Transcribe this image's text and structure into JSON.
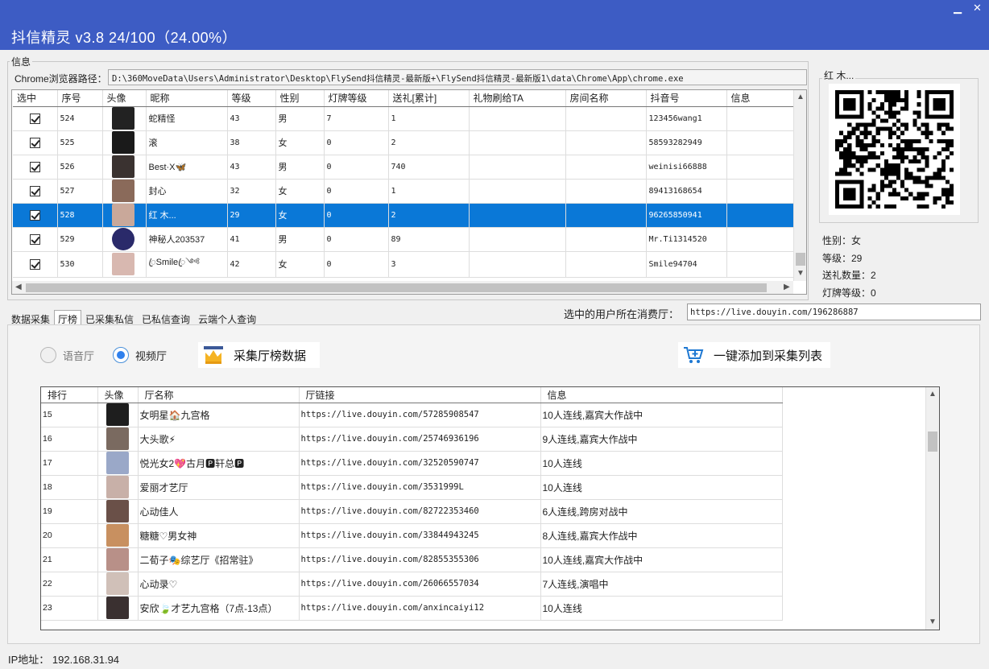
{
  "window": {
    "title": "抖信精灵 v3.8  24/100（24.00%）",
    "minimize": "▁",
    "close": "✕"
  },
  "info_group": {
    "label": "信息",
    "path_label": "Chrome浏览器路径：",
    "path_value": "D:\\360MoveData\\Users\\Administrator\\Desktop\\FlySend抖信精灵-最新版+\\FlySend抖信精灵-最新版1\\data\\Chrome\\App\\chrome.exe"
  },
  "user_table": {
    "columns": [
      "选中",
      "序号",
      "头像",
      "昵称",
      "等级",
      "性别",
      "灯牌等级",
      "送礼[累计]",
      "礼物刷给TA",
      "房间名称",
      "抖音号",
      "信息"
    ],
    "rows": [
      {
        "seq": "524",
        "nick": "蛇精怪",
        "level": "43",
        "gender": "男",
        "badge": "7",
        "gift": "1",
        "gift_to": "",
        "room": "",
        "douyin": "123456wang1",
        "info": "",
        "avatar_color": "#222222"
      },
      {
        "seq": "525",
        "nick": "滚",
        "level": "38",
        "gender": "女",
        "badge": "0",
        "gift": "2",
        "gift_to": "",
        "room": "",
        "douyin": "58593282949",
        "info": "",
        "avatar_color": "#1a1a1a"
      },
      {
        "seq": "526",
        "nick": "Best·X🦋",
        "level": "43",
        "gender": "男",
        "badge": "0",
        "gift": "740",
        "gift_to": "",
        "room": "",
        "douyin": "weinisi66888",
        "info": "",
        "avatar_color": "#3a3230"
      },
      {
        "seq": "527",
        "nick": "封心",
        "level": "32",
        "gender": "女",
        "badge": "0",
        "gift": "1",
        "gift_to": "",
        "room": "",
        "douyin": "89413168654",
        "info": "",
        "avatar_color": "#8a6a5a"
      },
      {
        "seq": "528",
        "nick": "红 木...",
        "level": "29",
        "gender": "女",
        "badge": "0",
        "gift": "2",
        "gift_to": "",
        "room": "",
        "douyin": "96265850941",
        "info": "",
        "avatar_color": "#c9a89a"
      },
      {
        "seq": "529",
        "nick": "神秘人203537",
        "level": "41",
        "gender": "男",
        "badge": "0",
        "gift": "89",
        "gift_to": "",
        "room": "",
        "douyin": "Mr.Ti1314520",
        "info": "",
        "avatar_color": "#2a2a6a"
      },
      {
        "seq": "530",
        "nick": "ꦿSmileꦿ༺",
        "level": "42",
        "gender": "女",
        "badge": "0",
        "gift": "3",
        "gift_to": "",
        "room": "",
        "douyin": "Smile94704",
        "info": "",
        "avatar_color": "#d8b8b0"
      }
    ],
    "selected_index": 4,
    "selected_color": "#0a78d7"
  },
  "profile": {
    "name": "红 木...",
    "gender": "性别：女",
    "level": "等级：29",
    "gift_count": "送礼数量：2",
    "badge_level": "灯牌等级：0"
  },
  "tabs": [
    {
      "label": "数据采集",
      "active": false
    },
    {
      "label": "厅榜",
      "active": true
    },
    {
      "label": "已采集私信",
      "active": false
    },
    {
      "label": "已私信查询",
      "active": false
    },
    {
      "label": "云端个人查询",
      "active": false
    }
  ],
  "hall_field": {
    "label": "选中的用户所在消费厅：",
    "value": "https://live.douyin.com/196286887"
  },
  "hall_panel": {
    "radio_voice": "语音厅",
    "radio_video": "视频厅",
    "collect_button": "采集厅榜数据",
    "add_button": "一键添加到采集列表",
    "columns": [
      "排行",
      "头像",
      "厅名称",
      "厅链接",
      "信息"
    ],
    "rows": [
      {
        "rank": "15",
        "name": "女明星🏠九宫格",
        "link": "https://live.douyin.com/57285908547",
        "info": "10人连线,嘉宾大作战中",
        "avatar_color": "#1e1e1e"
      },
      {
        "rank": "16",
        "name": "大头歌⚡",
        "link": "https://live.douyin.com/25746936196",
        "info": "9人连线,嘉宾大作战中",
        "avatar_color": "#7a6a60"
      },
      {
        "rank": "17",
        "name": "悦光女2💖古月🅿轩总🅿",
        "link": "https://live.douyin.com/32520590747",
        "info": "10人连线",
        "avatar_color": "#9aa8c8"
      },
      {
        "rank": "18",
        "name": "爱丽才艺厅",
        "link": "https://live.douyin.com/3531999L",
        "info": "10人连线",
        "avatar_color": "#c8b0a8"
      },
      {
        "rank": "19",
        "name": "心动佳人",
        "link": "https://live.douyin.com/82722353460",
        "info": "6人连线,跨房对战中",
        "avatar_color": "#6a5048"
      },
      {
        "rank": "20",
        "name": "糖糖♡男女神",
        "link": "https://live.douyin.com/33844943245",
        "info": "8人连线,嘉宾大作战中",
        "avatar_color": "#c89060"
      },
      {
        "rank": "21",
        "name": "二荀子🎭综艺厅《招常驻》",
        "link": "https://live.douyin.com/82855355306",
        "info": "10人连线,嘉宾大作战中",
        "avatar_color": "#b89088"
      },
      {
        "rank": "22",
        "name": "心动录♡",
        "link": "https://live.douyin.com/26066557034",
        "info": "7人连线,演唱中",
        "avatar_color": "#d0c0b8"
      },
      {
        "rank": "23",
        "name": "安欣🍃才艺九宫格（7点-13点）",
        "link": "https://live.douyin.com/anxincaiyi12",
        "info": "10人连线",
        "avatar_color": "#3a3030"
      }
    ]
  },
  "status": {
    "ip": "IP地址：  192.168.31.94"
  },
  "colors": {
    "titlebar": "#3d5cc4",
    "selection": "#0a78d7",
    "radio_accent": "#2f80ed"
  }
}
